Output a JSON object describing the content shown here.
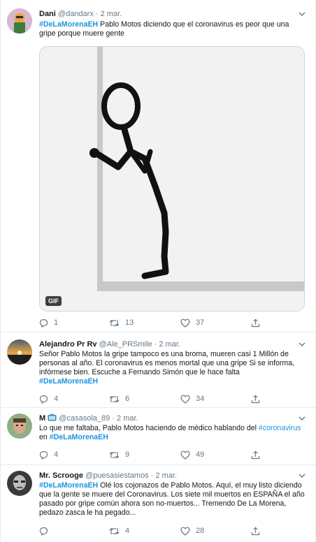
{
  "tweets": [
    {
      "name": "Dani",
      "handle": "@dandarx",
      "time": "2 mar.",
      "text_parts": {
        "hashtag": "#DeLaMorenaEH",
        "body": " Pablo Motos diciendo que el coronavirus es peor que una gripe porque muere gente"
      },
      "media_badge": "GIF",
      "replies": "1",
      "retweets": "13",
      "likes": "37"
    },
    {
      "name": "Alejandro Pr Rv",
      "handle": "@Ale_PRSmile",
      "time": "2 mar.",
      "text_parts": {
        "body": "Señor Pablo Motos la gripe tampoco es una broma, mueren casi 1 Millón de personas al año. El coronavirus es menos mortal que una gripe Si se informa, infórmese bien. Escuche a Fernando Simón que le hace falta",
        "hashtag": "#DeLaMorenaEH"
      },
      "replies": "4",
      "retweets": "6",
      "likes": "34"
    },
    {
      "name": "M",
      "handle": "@casasola_89",
      "time": "2 mar.",
      "text_parts": {
        "body_before": "Lo que me faltaba, Pablo Motos haciendo de médico hablando del ",
        "link": "#coronavirus",
        "body_mid": " en ",
        "hashtag": "#DeLaMorenaEH"
      },
      "replies": "4",
      "retweets": "9",
      "likes": "49"
    },
    {
      "name": "Mr. Scrooge",
      "handle": "@puesasiestamos",
      "time": "2 mar.",
      "text_parts": {
        "hashtag": "#DeLaMorenaEH",
        "body": " Olé los cojonazos de Pablo Motos. Aquí, el muy listo diciendo que la gente se muere del Coronavirus. Los siete mil muertos en ESPAÑA el año pasado por gripe común ahora son no-muertos... Tremendo De La Morena, pedazo zasca le ha pegado..."
      },
      "replies": "",
      "retweets": "4",
      "likes": "28"
    }
  ],
  "icons": {
    "reply": "reply-icon",
    "retweet": "retweet-icon",
    "like": "heart-icon",
    "share": "share-icon",
    "caret": "chevron-down-icon"
  },
  "colors": {
    "link": "#1b95e0",
    "muted": "#657786",
    "border": "#e6ecf0"
  }
}
